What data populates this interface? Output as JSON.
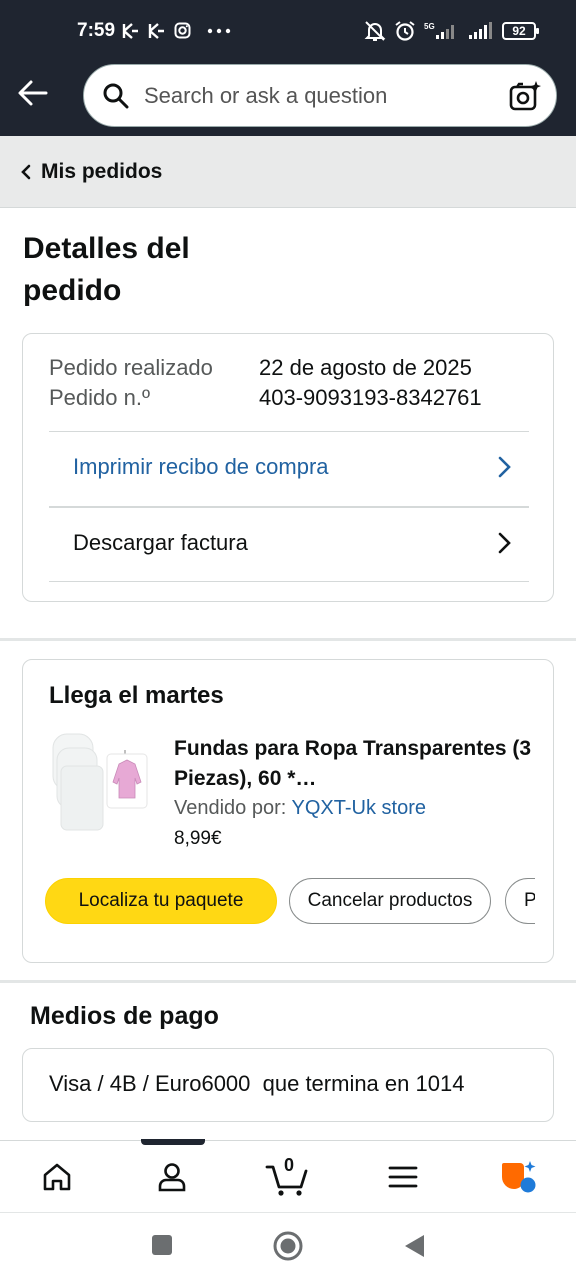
{
  "status_bar": {
    "time": "7:59",
    "battery": "92",
    "network": "5G"
  },
  "header": {
    "search_placeholder": "Search or ask a question"
  },
  "breadcrumb": {
    "label": "Mis pedidos"
  },
  "page_title": "Detalles del pedido",
  "order_info": {
    "placed_label": "Pedido realizado",
    "placed_value": "22 de agosto de 2025",
    "number_label": "Pedido n.º",
    "number_value": "403-9093193-8342761",
    "print_receipt": "Imprimir recibo de compra",
    "download_invoice": "Descargar factura"
  },
  "shipment": {
    "arrival": "Llega el martes",
    "product_title": "Fundas para Ropa Transparentes (3 Piezas), 60 *…",
    "sold_by_label": "Vendido por:",
    "seller": "YQXT-Uk store",
    "price": "8,99€",
    "buttons": {
      "track": "Localiza tu paquete",
      "cancel": "Cancelar productos",
      "ask": "Preg"
    }
  },
  "payment": {
    "title": "Medios de pago",
    "method": "Visa / 4B / Euro6000  que termina en 1014"
  },
  "bottom_nav": {
    "cart_count": "0"
  },
  "colors": {
    "header_bg": "#1f2530",
    "link": "#2162a1",
    "primary_button": "#ffd814",
    "breadcrumb_bg": "#e9eaea"
  }
}
